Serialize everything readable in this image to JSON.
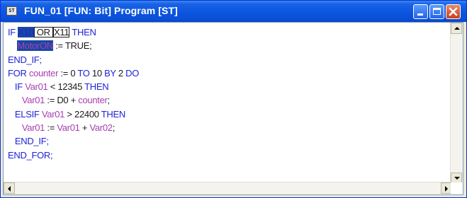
{
  "window": {
    "title": "FUN_01 [FUN: Bit] Program [ST]",
    "icon_text": "ST",
    "controls": {
      "minimize": "minimize-icon",
      "maximize": "maximize-icon",
      "close": "close-icon"
    }
  },
  "code": {
    "lines": [
      [
        {
          "t": "IF ",
          "c": "kw"
        },
        {
          "t": "X10",
          "c": "sel"
        },
        {
          "t": " OR ",
          "c": "box"
        },
        {
          "t": "X11",
          "c": "box"
        },
        {
          "t": " THEN",
          "c": "kw"
        }
      ],
      [
        {
          "t": "    ",
          "c": "tx"
        },
        {
          "t": "MotorON",
          "c": "selv"
        },
        {
          "t": " := TRUE;",
          "c": "tx"
        }
      ],
      [
        {
          "t": "END_IF;",
          "c": "kw"
        }
      ],
      [
        {
          "t": "FOR ",
          "c": "kw"
        },
        {
          "t": "counter",
          "c": "vr"
        },
        {
          "t": " := 0 ",
          "c": "tx"
        },
        {
          "t": "TO",
          "c": "kw"
        },
        {
          "t": " 10 ",
          "c": "tx"
        },
        {
          "t": "BY",
          "c": "kw"
        },
        {
          "t": " 2 ",
          "c": "tx"
        },
        {
          "t": "DO",
          "c": "kw"
        }
      ],
      [
        {
          "t": "   IF ",
          "c": "kw"
        },
        {
          "t": "Var01",
          "c": "vr"
        },
        {
          "t": " < 12345 ",
          "c": "tx"
        },
        {
          "t": "THEN",
          "c": "kw"
        }
      ],
      [
        {
          "t": "      ",
          "c": "tx"
        },
        {
          "t": "Var01",
          "c": "vr"
        },
        {
          "t": " := D0 + ",
          "c": "tx"
        },
        {
          "t": "counter",
          "c": "vr"
        },
        {
          "t": ";",
          "c": "tx"
        }
      ],
      [
        {
          "t": "   ELSIF ",
          "c": "kw"
        },
        {
          "t": "Var01",
          "c": "vr"
        },
        {
          "t": " > 22400 ",
          "c": "tx"
        },
        {
          "t": "THEN",
          "c": "kw"
        }
      ],
      [
        {
          "t": "      ",
          "c": "tx"
        },
        {
          "t": "Var01",
          "c": "vr"
        },
        {
          "t": " := ",
          "c": "tx"
        },
        {
          "t": "Var01",
          "c": "vr"
        },
        {
          "t": " + ",
          "c": "tx"
        },
        {
          "t": "Var02",
          "c": "vr"
        },
        {
          "t": ";",
          "c": "tx"
        }
      ],
      [
        {
          "t": "   END_IF;",
          "c": "kw"
        }
      ],
      [
        {
          "t": "END_FOR;",
          "c": "kw"
        }
      ]
    ]
  },
  "colors": {
    "keyword": "#1f23d8",
    "variable": "#a63fb0",
    "text": "#1a1a1a",
    "selection": "#1a47a3",
    "titlebar": "#0b55e0"
  },
  "scrollbars": {
    "up": "arrow-up-icon",
    "down": "arrow-down-icon",
    "left": "arrow-left-icon",
    "right": "arrow-right-icon"
  }
}
